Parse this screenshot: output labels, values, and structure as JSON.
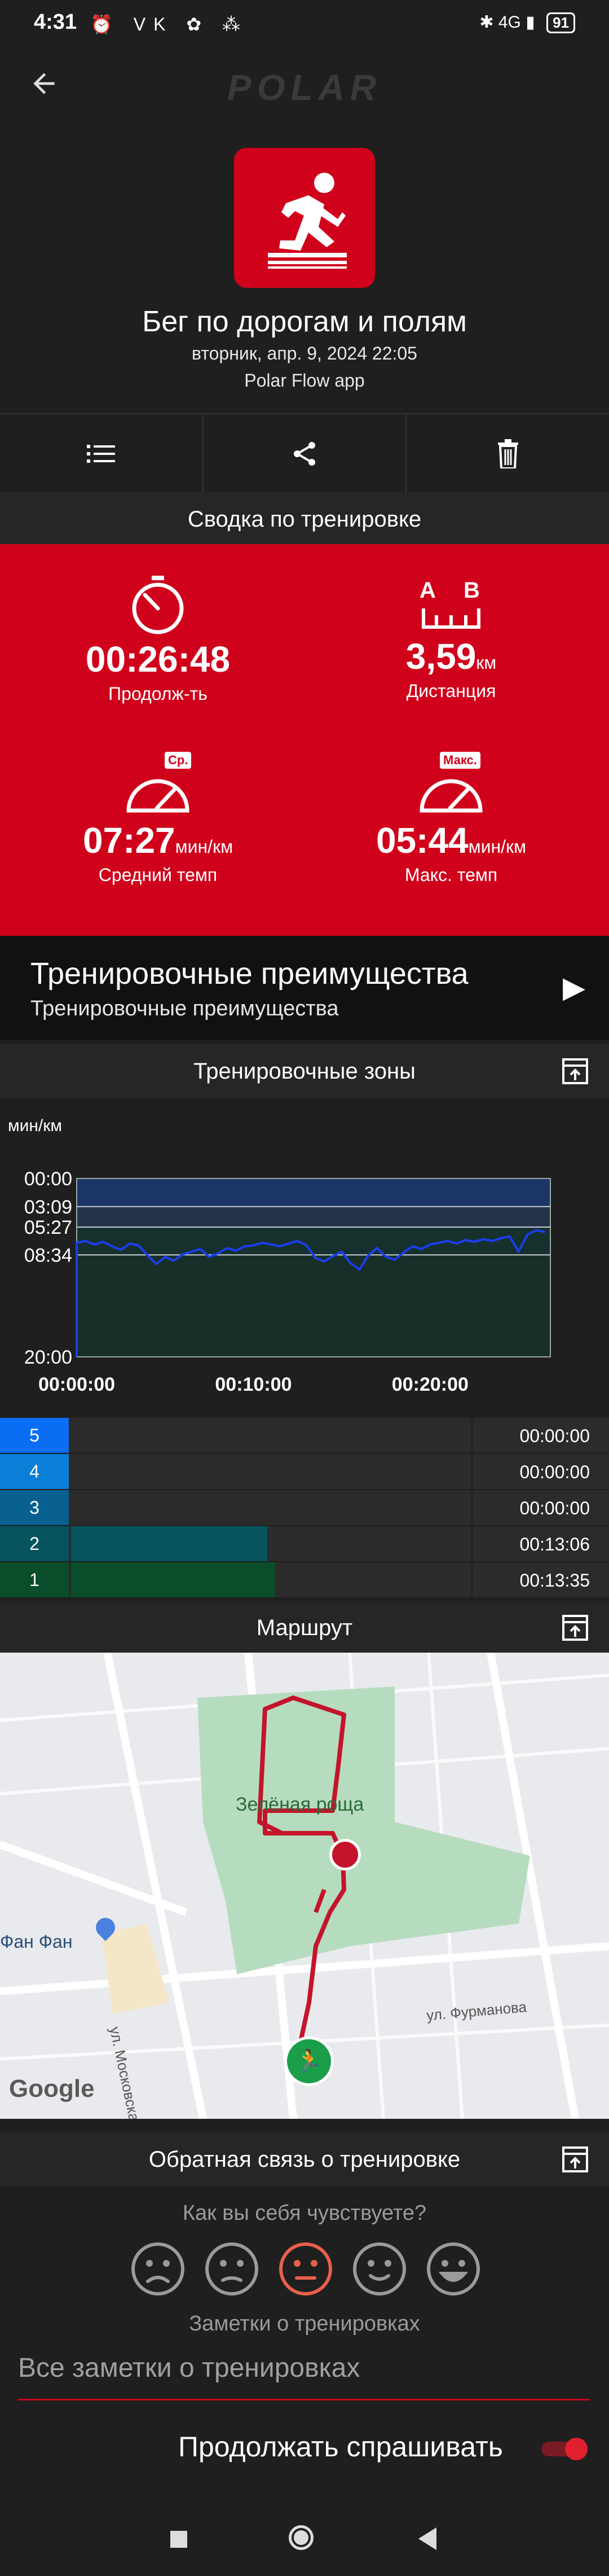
{
  "status_bar": {
    "time": "4:31",
    "left_icons": "⏰ VK ✿ ⁂",
    "right_icons": "✱ 4G ▮",
    "battery": "91"
  },
  "header": {
    "back_icon": "arrow-left-icon",
    "logo_text": "POLAR"
  },
  "workout": {
    "title": "Бег по дорогам и полям",
    "date": "вторник, апр. 9, 2024 22:05",
    "source": "Polar Flow app",
    "sport_icon": "trail-running-icon"
  },
  "actions": [
    {
      "icon": "list-icon"
    },
    {
      "icon": "share-icon"
    },
    {
      "icon": "trash-icon"
    }
  ],
  "summary": {
    "heading": "Сводка по тренировке",
    "duration": {
      "value": "00:26:48",
      "label": "Продолж-ть"
    },
    "distance": {
      "value": "3,59",
      "unit": "км",
      "label": "Дистанция",
      "icon_a": "A",
      "icon_b": "B"
    },
    "avg_pace": {
      "value": "07:27",
      "unit": "мин/км",
      "label": "Средний темп",
      "badge": "Ср."
    },
    "max_pace": {
      "value": "05:44",
      "unit": "мин/км",
      "label": "Макс. темп",
      "badge": "Макс."
    }
  },
  "benefit": {
    "title": "Тренировочные преимущества",
    "subtitle": "Тренировочные преимущества"
  },
  "zones_section": {
    "heading": "Тренировочные зоны"
  },
  "chart_data": {
    "type": "line",
    "ylabel": "мин/км",
    "y_ticks": [
      "00:00",
      "03:09",
      "05:27",
      "08:34",
      "20:00"
    ],
    "x_ticks": [
      "00:00:00",
      "00:10:00",
      "00:20:00"
    ],
    "ylim_min_per_km": [
      0,
      20
    ],
    "xlim_min": [
      0,
      26.8
    ],
    "series": [
      {
        "x": [
          0,
          0.5,
          1,
          1.5,
          2,
          2.5,
          3,
          3.5,
          4,
          4.5,
          5,
          5.5,
          6,
          6.5,
          7,
          7.5,
          8,
          8.5,
          9,
          9.5,
          10,
          10.5,
          11,
          11.5,
          12,
          12.5,
          13,
          13.5,
          14,
          14.5,
          15,
          15.5,
          16,
          16.5,
          17,
          17.5,
          18,
          18.5,
          19,
          19.5,
          20,
          20.5,
          21,
          21.5,
          22,
          22.5,
          23,
          23.5,
          24,
          24.5,
          25,
          25.5,
          26,
          26.5
        ],
        "values": [
          7.2,
          7.0,
          7.4,
          7.1,
          7.6,
          8.0,
          7.3,
          7.5,
          8.6,
          9.6,
          8.8,
          9.2,
          8.5,
          8.2,
          7.9,
          8.8,
          8.4,
          7.8,
          8.1,
          7.6,
          7.5,
          7.2,
          7.4,
          7.6,
          7.3,
          7.0,
          7.5,
          8.9,
          9.3,
          8.7,
          8.2,
          9.5,
          10.2,
          8.6,
          7.8,
          8.8,
          9.1,
          8.3,
          7.6,
          7.9,
          7.4,
          7.2,
          7.0,
          7.3,
          6.9,
          7.1,
          6.8,
          7.0,
          6.7,
          6.5,
          8.2,
          6.3,
          5.8,
          6.0
        ]
      }
    ],
    "zone_bands_min_per_km": [
      [
        0,
        3.15
      ],
      [
        3.15,
        5.45
      ],
      [
        5.45,
        8.57
      ],
      [
        8.57,
        20
      ]
    ]
  },
  "zones": [
    {
      "num": "5",
      "time": "00:00:00",
      "fraction": 0.0,
      "color": "#0a6ef5"
    },
    {
      "num": "4",
      "time": "00:00:00",
      "fraction": 0.0,
      "color": "#0a7fd8"
    },
    {
      "num": "3",
      "time": "00:00:00",
      "fraction": 0.0,
      "color": "#07608f"
    },
    {
      "num": "2",
      "time": "00:13:06",
      "fraction": 0.49,
      "color": "#05545e"
    },
    {
      "num": "1",
      "time": "00:13:35",
      "fraction": 0.51,
      "color": "#0a4d2a"
    }
  ],
  "route": {
    "heading": "Маршрут",
    "park_label": "Зелёная роща",
    "place_label": "Фан Фан",
    "street1": "ул. Московская",
    "street2": "ул. Фурманова",
    "google": "Google"
  },
  "feedback": {
    "heading": "Обратная связь о тренировке",
    "question": "Как вы себя чувствуете?",
    "notes_label": "Заметки о тренировках",
    "notes_placeholder": "Все заметки о тренировках",
    "keep_asking": "Продолжать спрашивать",
    "faces": [
      "very-sad-face-icon",
      "sad-face-icon",
      "neutral-face-icon",
      "happy-face-icon",
      "very-happy-face-icon"
    ],
    "selected_face_color": "#e8604c",
    "toggle_on": true
  },
  "colors": {
    "accent": "#d0021b",
    "background": "#1f1f1f"
  }
}
